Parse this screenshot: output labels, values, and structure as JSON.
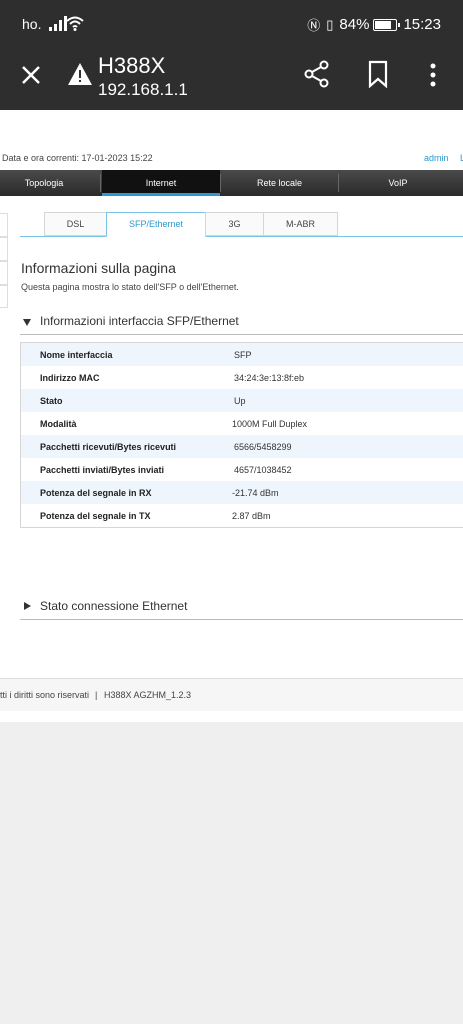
{
  "status_bar": {
    "carrier": "ho.",
    "battery_percent": "84%",
    "battery_level": 0.84,
    "time": "15:23",
    "icons": [
      "signal-icon",
      "wifi-icon",
      "nfc-icon",
      "vibrate-icon",
      "battery-icon"
    ]
  },
  "browser": {
    "title": "H388X",
    "url": "192.168.1.1",
    "icons": [
      "close-icon",
      "warning-icon",
      "share-icon",
      "bookmark-icon",
      "more-icon"
    ]
  },
  "header": {
    "datetime": "Data e ora correnti: 17-01-2023 15:22",
    "user": "admin",
    "user_extra": "L"
  },
  "nav": {
    "items": [
      "Topologia",
      "Internet",
      "Rete locale",
      "VoIP"
    ],
    "active": "Internet"
  },
  "tabs": {
    "items": [
      "DSL",
      "SFP/Ethernet",
      "3G",
      "M-ABR"
    ],
    "active": "SFP/Ethernet"
  },
  "page": {
    "title": "Informazioni sulla pagina",
    "description": "Questa pagina mostra lo stato dell'SFP o dell'Ethernet."
  },
  "interface_section": {
    "title": "Informazioni interfaccia SFP/Ethernet",
    "rows": [
      {
        "label": "Nome interfaccia",
        "value": "SFP"
      },
      {
        "label": "Indirizzo MAC",
        "value": "34:24:3e:13:8f:eb"
      },
      {
        "label": "Stato",
        "value": "Up"
      },
      {
        "label": "Modalità",
        "value": "1000M Full Duplex"
      },
      {
        "label": "Pacchetti ricevuti/Bytes ricevuti",
        "value": "6566/5458299"
      },
      {
        "label": "Pacchetti inviati/Bytes inviati",
        "value": "4657/1038452"
      },
      {
        "label": "Potenza del segnale in RX",
        "value": "-21.74 dBm"
      },
      {
        "label": "Potenza del segnale in TX",
        "value": "2.87 dBm"
      }
    ]
  },
  "ethernet_section": {
    "title": "Stato connessione Ethernet"
  },
  "footer": {
    "copyright": "tti i diritti sono riservati",
    "separator": "|",
    "version": "H388X AGZHM_1.2.3"
  },
  "colors": {
    "accent": "#2a9ad0",
    "toolbar": "#2e2e2e",
    "row_alt": "#eef5fc"
  }
}
